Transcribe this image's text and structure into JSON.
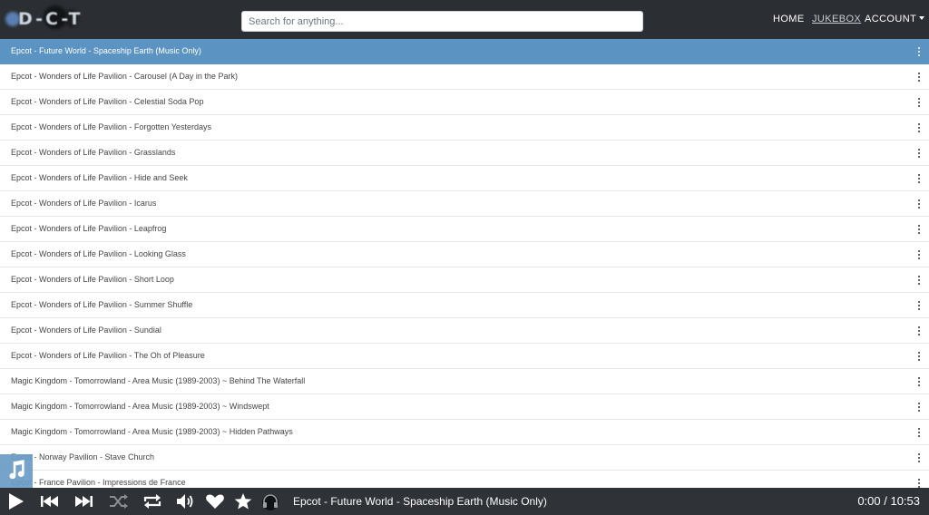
{
  "navbar": {
    "logo_text": "D-C-T",
    "search_placeholder": "Search for anything...",
    "links": {
      "home": "HOME",
      "jukebox": "JUKEBOX",
      "account": "ACCOUNT"
    }
  },
  "tracks": [
    {
      "title": "Epcot - Future World - Spaceship Earth (Music Only)",
      "active": true
    },
    {
      "title": "Epcot - Wonders of Life Pavilion - Carousel (A Day in the Park)"
    },
    {
      "title": "Epcot - Wonders of Life Pavilion - Celestial Soda Pop"
    },
    {
      "title": "Epcot - Wonders of Life Pavilion - Forgotten Yesterdays"
    },
    {
      "title": "Epcot - Wonders of Life Pavilion - Grasslands"
    },
    {
      "title": "Epcot - Wonders of Life Pavilion - Hide and Seek"
    },
    {
      "title": "Epcot - Wonders of Life Pavilion - Icarus"
    },
    {
      "title": "Epcot - Wonders of Life Pavilion - Leapfrog"
    },
    {
      "title": "Epcot - Wonders of Life Pavilion - Looking Glass"
    },
    {
      "title": "Epcot - Wonders of Life Pavilion - Short Loop"
    },
    {
      "title": "Epcot - Wonders of Life Pavilion - Summer Shuffle"
    },
    {
      "title": "Epcot - Wonders of Life Pavilion - Sundial"
    },
    {
      "title": "Epcot - Wonders of Life Pavilion - The Oh of Pleasure"
    },
    {
      "title": "Magic Kingdom - Tomorrowland - Area Music (1989-2003) ~ Behind The Waterfall"
    },
    {
      "title": "Magic Kingdom - Tomorrowland - Area Music (1989-2003) ~ Windswept"
    },
    {
      "title": "Magic Kingdom - Tomorrowland - Area Music (1989-2003) ~ Hidden Pathways"
    },
    {
      "title": "Epcot - Norway Pavilion - Stave Church"
    },
    {
      "title": "Epcot - France Pavilion - Impressions de France"
    }
  ],
  "player": {
    "now_playing": "Epcot - Future World - Spaceship Earth (Music Only)",
    "time": "0:00 / 10:53",
    "icons": [
      "play-icon",
      "previous-icon",
      "next-icon",
      "shuffle-icon",
      "repeat-icon",
      "volume-icon",
      "heart-icon",
      "star-icon",
      "headphones-icon"
    ]
  },
  "colors": {
    "navbar_bg": "#2b2e33",
    "active_row": "#5b93c3",
    "player_bg": "#2f3237",
    "note_button": "#6a9cc6"
  }
}
